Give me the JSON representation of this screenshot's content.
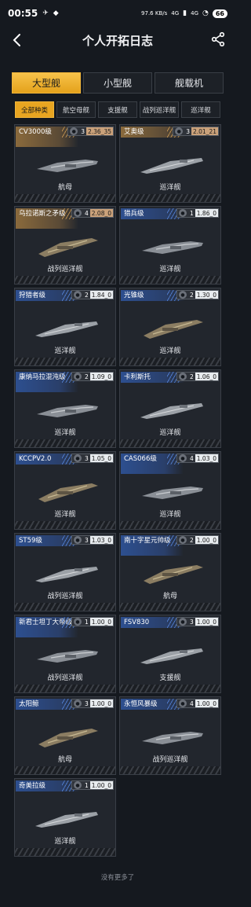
{
  "status": {
    "time": "00:55",
    "net_speed": "97.6 KB/s",
    "signal1": "4G",
    "signal2": "4G",
    "battery": "66"
  },
  "header": {
    "title": "个人开拓日志"
  },
  "main_tabs": [
    {
      "label": "大型舰",
      "active": true
    },
    {
      "label": "小型舰",
      "active": false
    },
    {
      "label": "舰载机",
      "active": false
    }
  ],
  "sub_tabs": [
    {
      "label": "全部种类",
      "active": true
    },
    {
      "label": "航空母舰",
      "active": false
    },
    {
      "label": "支援舰",
      "active": false
    },
    {
      "label": "战列巡洋舰",
      "active": false
    },
    {
      "label": "巡洋舰",
      "active": false
    }
  ],
  "ships": [
    {
      "name": "CV3000级",
      "count": "3",
      "version": "2.36_35",
      "type": "航母",
      "color": "orange"
    },
    {
      "name": "艾奥级",
      "count": "3",
      "version": "2.01_21",
      "type": "巡洋舰",
      "color": "orange"
    },
    {
      "name": "乌拉诺斯之矛级",
      "count": "4",
      "version": "2.08_0",
      "type": "战列巡洋舰",
      "color": "orange"
    },
    {
      "name": "猎兵级",
      "count": "1",
      "version": "1.86_0",
      "type": "巡洋舰",
      "color": "blue"
    },
    {
      "name": "狩猎者级",
      "count": "2",
      "version": "1.84_0",
      "type": "巡洋舰",
      "color": "blue"
    },
    {
      "name": "光锥级",
      "count": "2",
      "version": "1.30_0",
      "type": "巡洋舰",
      "color": "blue"
    },
    {
      "name": "康纳马拉混沌级",
      "count": "2",
      "version": "1.09_0",
      "type": "巡洋舰",
      "color": "blue"
    },
    {
      "name": "卡利斯托",
      "count": "2",
      "version": "1.06_0",
      "type": "巡洋舰",
      "color": "blue"
    },
    {
      "name": "KCCPV2.0",
      "count": "3",
      "version": "1.05_0",
      "type": "巡洋舰",
      "color": "blue"
    },
    {
      "name": "CAS066级",
      "count": "4",
      "version": "1.03_0",
      "type": "巡洋舰",
      "color": "blue"
    },
    {
      "name": "ST59级",
      "count": "3",
      "version": "1.03_0",
      "type": "战列巡洋舰",
      "color": "blue"
    },
    {
      "name": "南十字星元帅级",
      "count": "2",
      "version": "1.00_0",
      "type": "航母",
      "color": "blue"
    },
    {
      "name": "新君士坦丁大帝级",
      "count": "1",
      "version": "1.00_0",
      "type": "战列巡洋舰",
      "color": "blue"
    },
    {
      "name": "FSV830",
      "count": "3",
      "version": "1.00_0",
      "type": "支援舰",
      "color": "blue"
    },
    {
      "name": "太阳鲸",
      "count": "3",
      "version": "1.00_0",
      "type": "航母",
      "color": "blue"
    },
    {
      "name": "永恒风暴级",
      "count": "4",
      "version": "1.00_0",
      "type": "战列巡洋舰",
      "color": "blue"
    },
    {
      "name": "奇美拉级",
      "count": "1",
      "version": "1.00_0",
      "type": "巡洋舰",
      "color": "blue"
    }
  ],
  "footer": {
    "no_more": "没有更多了"
  }
}
